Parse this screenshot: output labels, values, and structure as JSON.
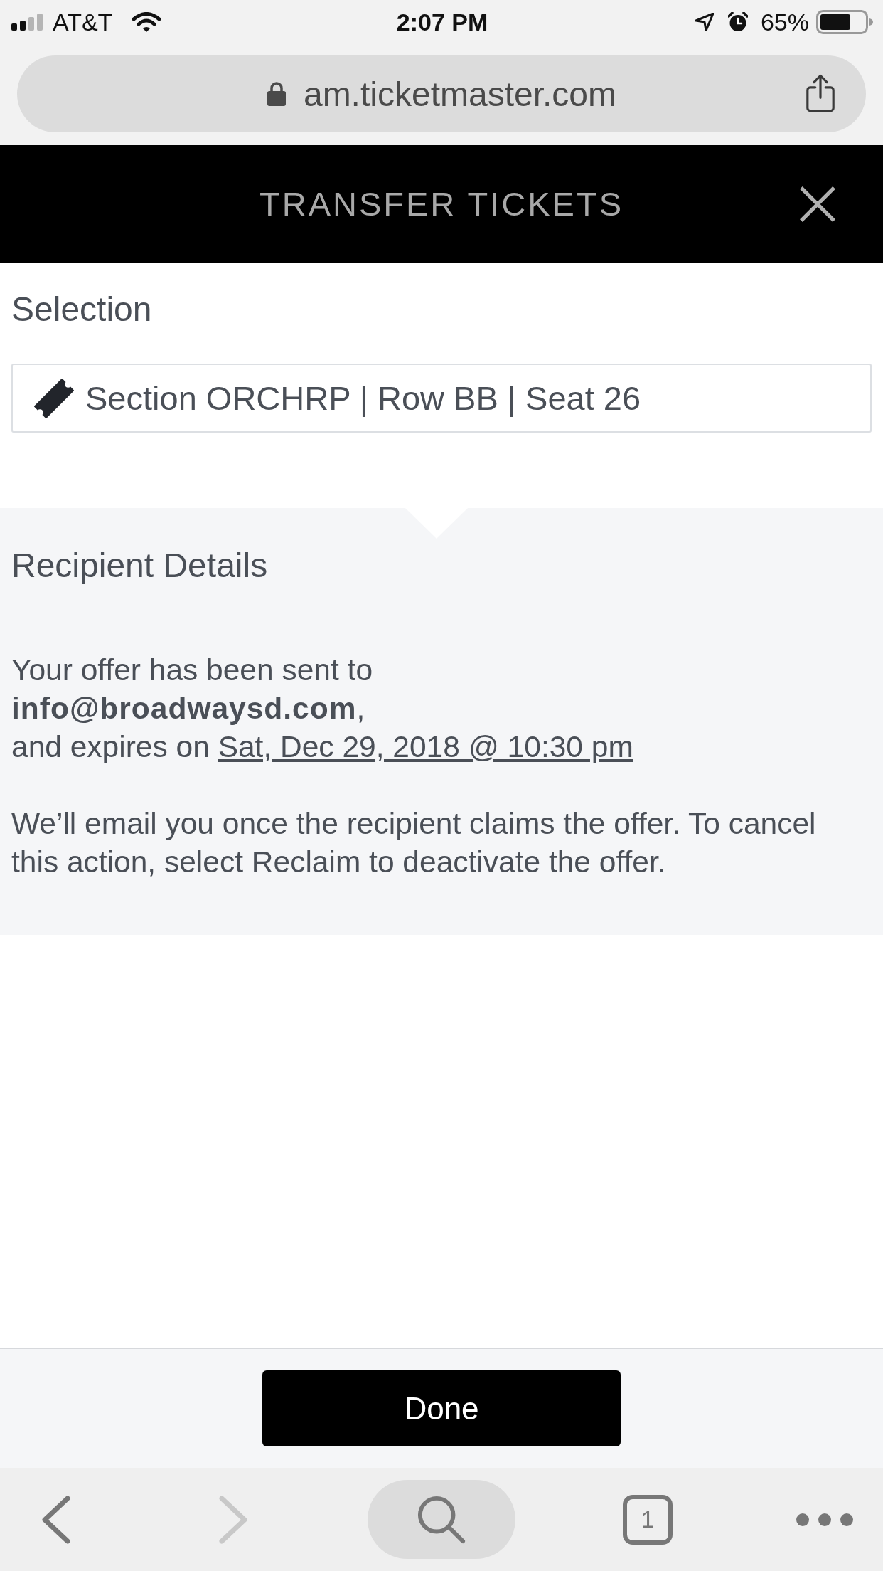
{
  "status_bar": {
    "carrier": "AT&T",
    "time": "2:07 PM",
    "battery_percent": "65%"
  },
  "browser": {
    "url": "am.ticketmaster.com"
  },
  "header": {
    "title": "TRANSFER TICKETS"
  },
  "selection": {
    "heading": "Selection",
    "ticket": "Section ORCHRP | Row BB | Seat 26"
  },
  "recipient": {
    "heading": "Recipient Details",
    "offer_text": "Your offer has been sent to\n**info@broadwaysd.com**,\nand expires on",
    "expiry_link": "Sat, Dec 29, 2018 @ 10:30 pm",
    "note": "We’ll email you once the recipient claims the offer. To cancel this action, select Reclaim to deactivate the offer."
  },
  "footer": {
    "done_button": "Done"
  },
  "toolbar": {
    "back": {
      "disabled": false
    },
    "forward": {
      "disabled": true
    },
    "tabs_count": "1"
  }
}
